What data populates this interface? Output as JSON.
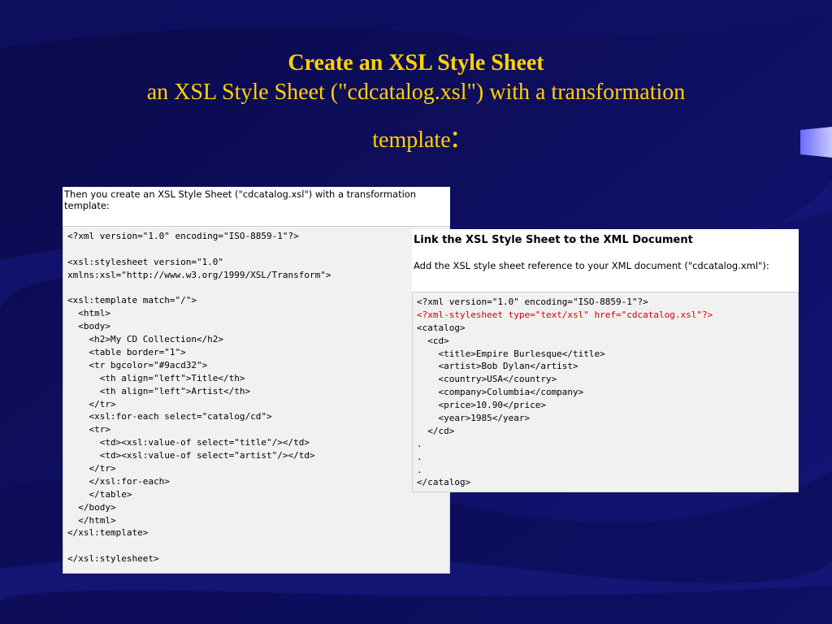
{
  "slide": {
    "title": "Create an XSL Style Sheet",
    "subtitle_line1": "an XSL Style Sheet (\"cdcatalog.xsl\") with a transformation",
    "subtitle_line2": "template",
    "subtitle_colon": ":"
  },
  "left_panel": {
    "intro": "Then you create an XSL Style Sheet (\"cdcatalog.xsl\") with a transformation template:",
    "code_lines": [
      "<?xml version=\"1.0\" encoding=\"ISO-8859-1\"?>",
      "",
      "<xsl:stylesheet version=\"1.0\"",
      "xmlns:xsl=\"http://www.w3.org/1999/XSL/Transform\">",
      "",
      "<xsl:template match=\"/\">",
      "  <html>",
      "  <body>",
      "    <h2>My CD Collection</h2>",
      "    <table border=\"1\">",
      "    <tr bgcolor=\"#9acd32\">",
      "      <th align=\"left\">Title</th>",
      "      <th align=\"left\">Artist</th>",
      "    </tr>",
      "    <xsl:for-each select=\"catalog/cd\">",
      "    <tr>",
      "      <td><xsl:value-of select=\"title\"/></td>",
      "      <td><xsl:value-of select=\"artist\"/></td>",
      "    </tr>",
      "    </xsl:for-each>",
      "    </table>",
      "  </body>",
      "  </html>",
      "</xsl:template>",
      "",
      "</xsl:stylesheet>"
    ]
  },
  "right_panel": {
    "heading": "Link the XSL Style Sheet to the XML Document",
    "intro": "Add the XSL style sheet reference to your XML document (\"cdcatalog.xml\"):",
    "code_lines": [
      {
        "text": "<?xml version=\"1.0\" encoding=\"ISO-8859-1\"?>",
        "red": false
      },
      {
        "text": "<?xml-stylesheet type=\"text/xsl\" href=\"cdcatalog.xsl\"?>",
        "red": true
      },
      {
        "text": "<catalog>",
        "red": false
      },
      {
        "text": "  <cd>",
        "red": false
      },
      {
        "text": "    <title>Empire Burlesque</title>",
        "red": false
      },
      {
        "text": "    <artist>Bob Dylan</artist>",
        "red": false
      },
      {
        "text": "    <country>USA</country>",
        "red": false
      },
      {
        "text": "    <company>Columbia</company>",
        "red": false
      },
      {
        "text": "    <price>10.90</price>",
        "red": false
      },
      {
        "text": "    <year>1985</year>",
        "red": false
      },
      {
        "text": "  </cd>",
        "red": false
      },
      {
        "text": ".",
        "red": false
      },
      {
        "text": ".",
        "red": false
      },
      {
        "text": ".",
        "red": false
      },
      {
        "text": "</catalog>",
        "red": false
      }
    ]
  },
  "colors": {
    "title": "#ffd200",
    "background": "#0a0a5c",
    "highlight_code": "#d40000",
    "code_background": "#f1f1f1"
  }
}
